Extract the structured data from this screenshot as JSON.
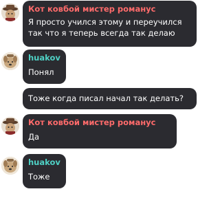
{
  "colors": {
    "bubble_bg": "#2b2b30",
    "author_kovboy": "#ff6b6b",
    "author_huakov": "#4fd1c5",
    "text": "#ffffff"
  },
  "messages": [
    {
      "author": "Кот ковбой мистер романус",
      "lines": [
        "Я просто учился этому и переучился",
        "так что я теперь всегда так делаю"
      ],
      "avatar": "cowboy-cat-avatar"
    },
    {
      "author": "huakov",
      "lines": [
        "Понял"
      ],
      "avatar": "dog-avatar"
    },
    {
      "author": "",
      "lines": [
        "Тоже когда писал начал так делать?"
      ],
      "avatar": ""
    },
    {
      "author": "Кот ковбой мистер романус",
      "lines": [
        "Да"
      ],
      "avatar": "cowboy-cat-avatar"
    },
    {
      "author": "huakov",
      "lines": [
        "Тоже"
      ],
      "avatar": "dog-avatar"
    }
  ]
}
